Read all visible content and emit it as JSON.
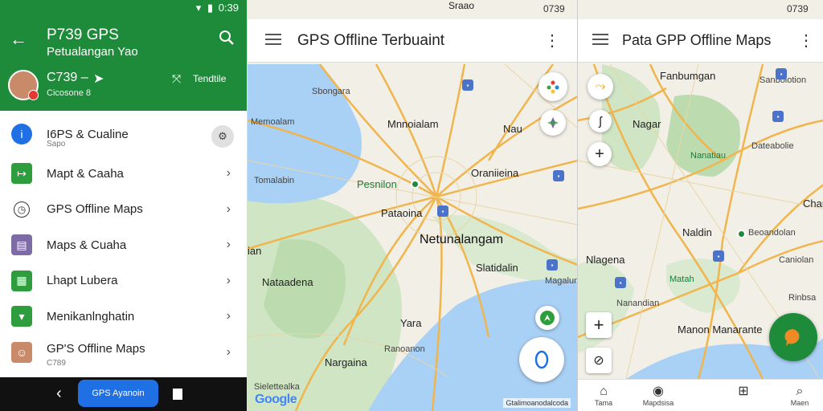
{
  "panel1": {
    "status_time": "0:39",
    "status_icons": "▾ ▮",
    "header": {
      "title": "P739 GPS",
      "subtitle": "Petualangan Yao",
      "account_name": "C739 –",
      "account_sub": "Cicosone 8",
      "right_label": "Tendtile"
    },
    "items": [
      {
        "label": "I6PS & Cualine",
        "sub": "Sapo",
        "color": "#1f6fe5",
        "icon": "i"
      },
      {
        "label": "Mapt & Caaha",
        "color": "#2e9d3e",
        "icon": "↦"
      },
      {
        "label": "GPS Offline Maps",
        "color": "#ffffff",
        "icon": "◷"
      },
      {
        "label": "Maps & Cuaha",
        "color": "#7d6ba5",
        "icon": "▤"
      },
      {
        "label": "Lhapt Lubera",
        "color": "#2e9d3e",
        "icon": "▦"
      },
      {
        "label": "Menikanlnghatin",
        "color": "#2e9d3e",
        "icon": "▾"
      },
      {
        "label": "GP'S Offline Maps",
        "sub": "C789",
        "color": "#c98a6a",
        "icon": "☺"
      }
    ],
    "nav_pill": "GPS Ayanoin"
  },
  "panel2": {
    "status_time": "0739",
    "top_label": "Sraao",
    "title": "GPS Offline Terbuaint",
    "labels": {
      "sbangara": "Sbongara",
      "memoalam": "Memoalam",
      "mnoialam": "Mnnoialam",
      "nau": "Nau",
      "oranleina": "Oraniieina",
      "tomalabin": "Tomalabin",
      "pesnilon": "Pesnilon",
      "pataoina": "Pataoina",
      "netunalangam": "Netunalangam",
      "ian": "ian",
      "slateidalin": "Slatidalin",
      "magalurm": "Magalum",
      "nataadena": "Nataadena",
      "yara": "Yara",
      "nargaina": "Nargaina",
      "ranoanon": "Ranoanon",
      "sieletreiha": "Sielettealka"
    },
    "google": "Google",
    "scale": "Gtalimoanodalcoda"
  },
  "panel3": {
    "status_time": "0739",
    "title": "Pata GPP Offline Maps",
    "labels": {
      "fanbungan": "Fanbumgan",
      "sanbolotion": "Sanbolotion",
      "nagar": "Nagar",
      "nanatiau": "Nanatiau",
      "dateabolie": "Dateabolie",
      "char": "Char",
      "naldin": "Naldin",
      "beoandolan": "Beoandolan",
      "nlagena": "Nlagena",
      "matah": "Matah",
      "caniolan": "Caniolan",
      "nanandian": "Nanandian",
      "manon": "Manon Manarante",
      "rinbsa": "Rinbsa"
    },
    "bottom_nav": [
      "Tama",
      "Mapdsisa",
      "",
      "Maen"
    ]
  }
}
